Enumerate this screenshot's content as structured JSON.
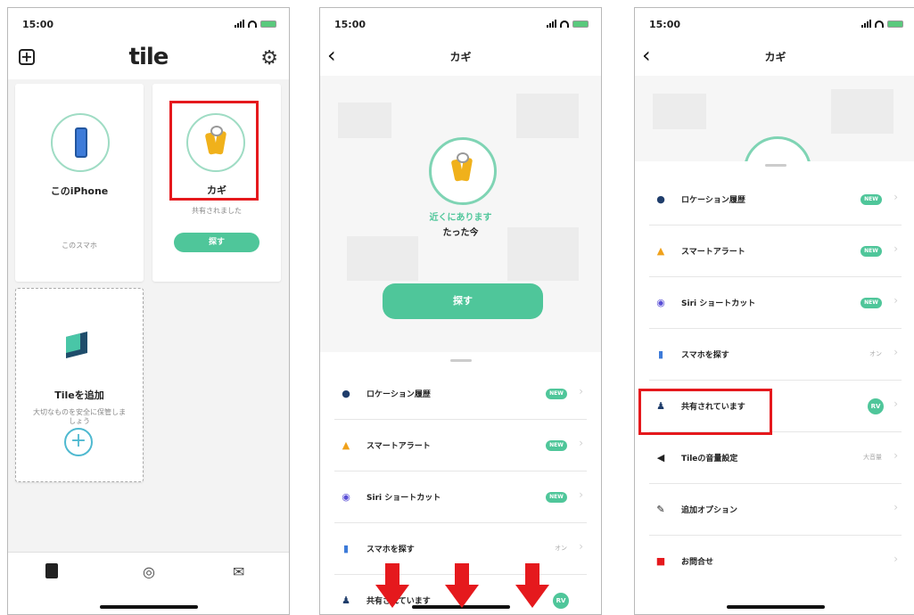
{
  "phone1": {
    "status_time": "15:00",
    "logo": "tile",
    "card_iphone": {
      "name": "このiPhone",
      "sub": "このスマホ"
    },
    "card_keys": {
      "name": "カギ",
      "sub": "共有されました",
      "button": "探す"
    },
    "card_add": {
      "name": "Tileを追加",
      "sub": "大切なものを安全に保管しましょう",
      "plus": "+"
    },
    "tabs": [
      "tile-icon",
      "location-icon",
      "mail-icon"
    ]
  },
  "phone2": {
    "status_time": "15:00",
    "title": "カギ",
    "near": "近くにあります",
    "time": "たった今",
    "button": "探す",
    "rows": [
      {
        "label": "ロケーション履歴",
        "badge": "NEW"
      },
      {
        "label": "スマートアラート",
        "badge": "NEW"
      },
      {
        "label": "Siri ショートカット",
        "badge": "NEW"
      },
      {
        "label": "スマホを探す",
        "value": "オン"
      },
      {
        "label": "共有されています",
        "avatar": "RV"
      }
    ]
  },
  "phone3": {
    "status_time": "15:00",
    "title": "カギ",
    "rows": [
      {
        "label": "ロケーション履歴",
        "badge": "NEW"
      },
      {
        "label": "スマートアラート",
        "badge": "NEW"
      },
      {
        "label": "Siri ショートカット",
        "badge": "NEW"
      },
      {
        "label": "スマホを探す",
        "value": "オン"
      },
      {
        "label": "共有されています",
        "avatar": "RV"
      },
      {
        "label": "Tileの音量設定",
        "value": "大音量"
      },
      {
        "label": "追加オプション"
      },
      {
        "label": "お問合せ"
      }
    ]
  },
  "colors": {
    "accent": "#4fc69a",
    "highlight": "#e5191d"
  }
}
